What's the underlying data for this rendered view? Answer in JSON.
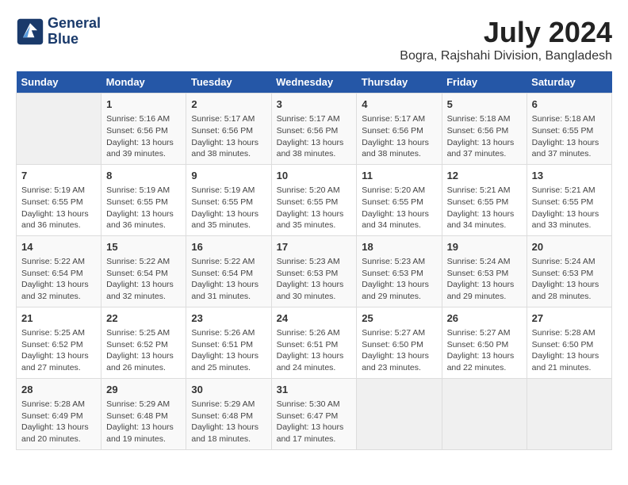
{
  "header": {
    "logo_line1": "General",
    "logo_line2": "Blue",
    "month_year": "July 2024",
    "location": "Bogra, Rajshahi Division, Bangladesh"
  },
  "weekdays": [
    "Sunday",
    "Monday",
    "Tuesday",
    "Wednesday",
    "Thursday",
    "Friday",
    "Saturday"
  ],
  "weeks": [
    [
      {
        "day": "",
        "info": ""
      },
      {
        "day": "1",
        "info": "Sunrise: 5:16 AM\nSunset: 6:56 PM\nDaylight: 13 hours\nand 39 minutes."
      },
      {
        "day": "2",
        "info": "Sunrise: 5:17 AM\nSunset: 6:56 PM\nDaylight: 13 hours\nand 38 minutes."
      },
      {
        "day": "3",
        "info": "Sunrise: 5:17 AM\nSunset: 6:56 PM\nDaylight: 13 hours\nand 38 minutes."
      },
      {
        "day": "4",
        "info": "Sunrise: 5:17 AM\nSunset: 6:56 PM\nDaylight: 13 hours\nand 38 minutes."
      },
      {
        "day": "5",
        "info": "Sunrise: 5:18 AM\nSunset: 6:56 PM\nDaylight: 13 hours\nand 37 minutes."
      },
      {
        "day": "6",
        "info": "Sunrise: 5:18 AM\nSunset: 6:55 PM\nDaylight: 13 hours\nand 37 minutes."
      }
    ],
    [
      {
        "day": "7",
        "info": "Sunrise: 5:19 AM\nSunset: 6:55 PM\nDaylight: 13 hours\nand 36 minutes."
      },
      {
        "day": "8",
        "info": "Sunrise: 5:19 AM\nSunset: 6:55 PM\nDaylight: 13 hours\nand 36 minutes."
      },
      {
        "day": "9",
        "info": "Sunrise: 5:19 AM\nSunset: 6:55 PM\nDaylight: 13 hours\nand 35 minutes."
      },
      {
        "day": "10",
        "info": "Sunrise: 5:20 AM\nSunset: 6:55 PM\nDaylight: 13 hours\nand 35 minutes."
      },
      {
        "day": "11",
        "info": "Sunrise: 5:20 AM\nSunset: 6:55 PM\nDaylight: 13 hours\nand 34 minutes."
      },
      {
        "day": "12",
        "info": "Sunrise: 5:21 AM\nSunset: 6:55 PM\nDaylight: 13 hours\nand 34 minutes."
      },
      {
        "day": "13",
        "info": "Sunrise: 5:21 AM\nSunset: 6:55 PM\nDaylight: 13 hours\nand 33 minutes."
      }
    ],
    [
      {
        "day": "14",
        "info": "Sunrise: 5:22 AM\nSunset: 6:54 PM\nDaylight: 13 hours\nand 32 minutes."
      },
      {
        "day": "15",
        "info": "Sunrise: 5:22 AM\nSunset: 6:54 PM\nDaylight: 13 hours\nand 32 minutes."
      },
      {
        "day": "16",
        "info": "Sunrise: 5:22 AM\nSunset: 6:54 PM\nDaylight: 13 hours\nand 31 minutes."
      },
      {
        "day": "17",
        "info": "Sunrise: 5:23 AM\nSunset: 6:53 PM\nDaylight: 13 hours\nand 30 minutes."
      },
      {
        "day": "18",
        "info": "Sunrise: 5:23 AM\nSunset: 6:53 PM\nDaylight: 13 hours\nand 29 minutes."
      },
      {
        "day": "19",
        "info": "Sunrise: 5:24 AM\nSunset: 6:53 PM\nDaylight: 13 hours\nand 29 minutes."
      },
      {
        "day": "20",
        "info": "Sunrise: 5:24 AM\nSunset: 6:53 PM\nDaylight: 13 hours\nand 28 minutes."
      }
    ],
    [
      {
        "day": "21",
        "info": "Sunrise: 5:25 AM\nSunset: 6:52 PM\nDaylight: 13 hours\nand 27 minutes."
      },
      {
        "day": "22",
        "info": "Sunrise: 5:25 AM\nSunset: 6:52 PM\nDaylight: 13 hours\nand 26 minutes."
      },
      {
        "day": "23",
        "info": "Sunrise: 5:26 AM\nSunset: 6:51 PM\nDaylight: 13 hours\nand 25 minutes."
      },
      {
        "day": "24",
        "info": "Sunrise: 5:26 AM\nSunset: 6:51 PM\nDaylight: 13 hours\nand 24 minutes."
      },
      {
        "day": "25",
        "info": "Sunrise: 5:27 AM\nSunset: 6:50 PM\nDaylight: 13 hours\nand 23 minutes."
      },
      {
        "day": "26",
        "info": "Sunrise: 5:27 AM\nSunset: 6:50 PM\nDaylight: 13 hours\nand 22 minutes."
      },
      {
        "day": "27",
        "info": "Sunrise: 5:28 AM\nSunset: 6:50 PM\nDaylight: 13 hours\nand 21 minutes."
      }
    ],
    [
      {
        "day": "28",
        "info": "Sunrise: 5:28 AM\nSunset: 6:49 PM\nDaylight: 13 hours\nand 20 minutes."
      },
      {
        "day": "29",
        "info": "Sunrise: 5:29 AM\nSunset: 6:48 PM\nDaylight: 13 hours\nand 19 minutes."
      },
      {
        "day": "30",
        "info": "Sunrise: 5:29 AM\nSunset: 6:48 PM\nDaylight: 13 hours\nand 18 minutes."
      },
      {
        "day": "31",
        "info": "Sunrise: 5:30 AM\nSunset: 6:47 PM\nDaylight: 13 hours\nand 17 minutes."
      },
      {
        "day": "",
        "info": ""
      },
      {
        "day": "",
        "info": ""
      },
      {
        "day": "",
        "info": ""
      }
    ]
  ]
}
